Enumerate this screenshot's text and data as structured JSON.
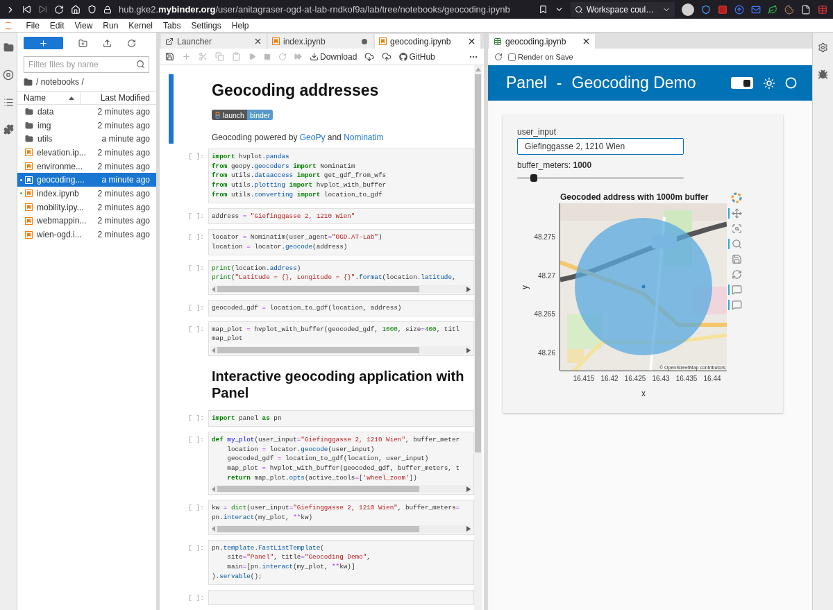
{
  "browser": {
    "url": "hub.gke2.**mybinder.org**/user/anitagraser-ogd-at-lab-rndkof9a/lab/tree/notebooks/geocoding.ipynb",
    "search": "Workspace coul…"
  },
  "menu": [
    "File",
    "Edit",
    "View",
    "Run",
    "Kernel",
    "Tabs",
    "Settings",
    "Help"
  ],
  "file_browser": {
    "filter_placeholder": "Filter files by name",
    "path": "/ notebooks /",
    "columns": [
      "Name",
      "Last Modified"
    ],
    "items": [
      {
        "kind": "folder",
        "name": "data",
        "modified": "2 minutes ago",
        "selected": false,
        "running": false
      },
      {
        "kind": "folder",
        "name": "img",
        "modified": "2 minutes ago",
        "selected": false,
        "running": false
      },
      {
        "kind": "folder",
        "name": "utils",
        "modified": "a minute ago",
        "selected": false,
        "running": false
      },
      {
        "kind": "notebook",
        "name": "elevation.ip...",
        "modified": "2 minutes ago",
        "selected": false,
        "running": false
      },
      {
        "kind": "notebook",
        "name": "environme...",
        "modified": "2 minutes ago",
        "selected": false,
        "running": false
      },
      {
        "kind": "notebook",
        "name": "geocoding....",
        "modified": "a minute ago",
        "selected": true,
        "running": true
      },
      {
        "kind": "notebook",
        "name": "index.ipynb",
        "modified": "2 minutes ago",
        "selected": false,
        "running": true
      },
      {
        "kind": "notebook",
        "name": "mobility.ipy...",
        "modified": "2 minutes ago",
        "selected": false,
        "running": false
      },
      {
        "kind": "notebook",
        "name": "webmappin...",
        "modified": "2 minutes ago",
        "selected": false,
        "running": false
      },
      {
        "kind": "notebook",
        "name": "wien-ogd.i...",
        "modified": "2 minutes ago",
        "selected": false,
        "running": false
      }
    ]
  },
  "notebook": {
    "tabs": [
      {
        "kind": "launcher",
        "label": "Launcher",
        "selected": false,
        "modified": false
      },
      {
        "kind": "notebook",
        "label": "index.ipynb",
        "selected": false,
        "modified": true
      },
      {
        "kind": "notebook",
        "label": "geocoding.ipynb",
        "selected": true,
        "modified": false
      }
    ],
    "toolbar": {
      "download": "Download",
      "github": "GitHub"
    },
    "cells": [
      {
        "kind": "markdown",
        "active": true,
        "heading": "Geocoding addresses",
        "badge": [
          "launch",
          "binder"
        ],
        "paragraph": [
          {
            "text": "Geocoding powered by ",
            "link": false
          },
          {
            "text": "GeoPy",
            "link": true
          },
          {
            "text": " and ",
            "link": false
          },
          {
            "text": "Nominatim",
            "link": true
          }
        ]
      },
      {
        "kind": "code",
        "active": false,
        "prompt": "[ ]:",
        "scrollbar": false,
        "lines": [
          [
            {
              "kind": "keyword",
              "text": "import"
            },
            {
              "kind": "plain",
              "text": " hvplot."
            },
            {
              "kind": "attribute",
              "text": "pandas"
            }
          ],
          [
            {
              "kind": "keyword",
              "text": "from"
            },
            {
              "kind": "plain",
              "text": " geopy."
            },
            {
              "kind": "attribute",
              "text": "geocoders"
            },
            {
              "kind": "keyword",
              "text": " import"
            },
            {
              "kind": "plain",
              "text": " Nominatim"
            }
          ],
          [
            {
              "kind": "keyword",
              "text": "from"
            },
            {
              "kind": "plain",
              "text": " utils."
            },
            {
              "kind": "attribute",
              "text": "dataaccess"
            },
            {
              "kind": "keyword",
              "text": " import"
            },
            {
              "kind": "plain",
              "text": " get_gdf_from_wfs"
            }
          ],
          [
            {
              "kind": "keyword",
              "text": "from"
            },
            {
              "kind": "plain",
              "text": " utils."
            },
            {
              "kind": "attribute",
              "text": "plotting"
            },
            {
              "kind": "keyword",
              "text": " import"
            },
            {
              "kind": "plain",
              "text": " hvplot_with_buffer"
            }
          ],
          [
            {
              "kind": "keyword",
              "text": "from"
            },
            {
              "kind": "plain",
              "text": " utils."
            },
            {
              "kind": "attribute",
              "text": "converting"
            },
            {
              "kind": "keyword",
              "text": " import"
            },
            {
              "kind": "plain",
              "text": " location_to_gdf"
            }
          ]
        ]
      },
      {
        "kind": "code",
        "active": false,
        "prompt": "[ ]:",
        "scrollbar": false,
        "lines": [
          [
            {
              "kind": "plain",
              "text": "address "
            },
            {
              "kind": "operator",
              "text": "="
            },
            {
              "kind": "string",
              "text": " \"Giefinggasse 2, 1210 Wien\""
            }
          ]
        ]
      },
      {
        "kind": "code",
        "active": false,
        "prompt": "[ ]:",
        "scrollbar": false,
        "lines": [
          [
            {
              "kind": "plain",
              "text": "locator "
            },
            {
              "kind": "operator",
              "text": "="
            },
            {
              "kind": "plain",
              "text": " Nominatim(user_agent"
            },
            {
              "kind": "operator",
              "text": "="
            },
            {
              "kind": "string",
              "text": "\"OGD.AT-Lab\""
            },
            {
              "kind": "plain",
              "text": ")"
            }
          ],
          [
            {
              "kind": "plain",
              "text": "location "
            },
            {
              "kind": "operator",
              "text": "="
            },
            {
              "kind": "plain",
              "text": " locator."
            },
            {
              "kind": "attribute",
              "text": "geocode"
            },
            {
              "kind": "plain",
              "text": "(address)"
            }
          ]
        ]
      },
      {
        "kind": "code",
        "active": false,
        "prompt": "[ ]:",
        "scrollbar": true,
        "lines": [
          [
            {
              "kind": "builtin",
              "text": "print"
            },
            {
              "kind": "plain",
              "text": "(location."
            },
            {
              "kind": "attribute",
              "text": "address"
            },
            {
              "kind": "plain",
              "text": ")"
            }
          ],
          [
            {
              "kind": "builtin",
              "text": "print"
            },
            {
              "kind": "plain",
              "text": "("
            },
            {
              "kind": "string",
              "text": "\"Latitude = {}, Longitude = {}\""
            },
            {
              "kind": "plain",
              "text": "."
            },
            {
              "kind": "attribute",
              "text": "format"
            },
            {
              "kind": "plain",
              "text": "(location."
            },
            {
              "kind": "attribute",
              "text": "latitude"
            },
            {
              "kind": "plain",
              "text": ","
            }
          ]
        ]
      },
      {
        "kind": "code",
        "active": false,
        "prompt": "[ ]:",
        "scrollbar": false,
        "lines": [
          [
            {
              "kind": "plain",
              "text": "geocoded_gdf "
            },
            {
              "kind": "operator",
              "text": "="
            },
            {
              "kind": "plain",
              "text": " location_to_gdf(location, address)"
            }
          ]
        ]
      },
      {
        "kind": "code",
        "active": false,
        "prompt": "[ ]:",
        "scrollbar": true,
        "lines": [
          [
            {
              "kind": "plain",
              "text": "map_plot "
            },
            {
              "kind": "operator",
              "text": "="
            },
            {
              "kind": "plain",
              "text": " hvplot_with_buffer(geocoded_gdf, "
            },
            {
              "kind": "number",
              "text": "1000"
            },
            {
              "kind": "plain",
              "text": ", size"
            },
            {
              "kind": "operator",
              "text": "="
            },
            {
              "kind": "number",
              "text": "400"
            },
            {
              "kind": "plain",
              "text": ", titl"
            }
          ],
          [
            {
              "kind": "plain",
              "text": "map_plot"
            }
          ]
        ]
      },
      {
        "kind": "heading",
        "active": false,
        "heading": "Interactive geocoding application with Panel"
      },
      {
        "kind": "code",
        "active": false,
        "prompt": "[ ]:",
        "scrollbar": false,
        "lines": [
          [
            {
              "kind": "keyword",
              "text": "import"
            },
            {
              "kind": "plain",
              "text": " panel "
            },
            {
              "kind": "keyword",
              "text": "as"
            },
            {
              "kind": "plain",
              "text": " pn"
            }
          ]
        ]
      },
      {
        "kind": "code",
        "active": false,
        "prompt": "[ ]:",
        "scrollbar": true,
        "lines": [
          [
            {
              "kind": "keyword",
              "text": "def"
            },
            {
              "kind": "function",
              "text": " my_plot"
            },
            {
              "kind": "plain",
              "text": "(user_input"
            },
            {
              "kind": "operator",
              "text": "="
            },
            {
              "kind": "string",
              "text": "\"Giefinggasse 2, 1210 Wien\""
            },
            {
              "kind": "plain",
              "text": ", buffer_meter"
            }
          ],
          [
            {
              "kind": "plain",
              "text": "    location "
            },
            {
              "kind": "operator",
              "text": "="
            },
            {
              "kind": "plain",
              "text": " locator."
            },
            {
              "kind": "attribute",
              "text": "geocode"
            },
            {
              "kind": "plain",
              "text": "(user_input)"
            }
          ],
          [
            {
              "kind": "plain",
              "text": "    geocoded_gdf "
            },
            {
              "kind": "operator",
              "text": "="
            },
            {
              "kind": "plain",
              "text": " location_to_gdf(location, user_input)"
            }
          ],
          [
            {
              "kind": "plain",
              "text": "    map_plot "
            },
            {
              "kind": "operator",
              "text": "="
            },
            {
              "kind": "plain",
              "text": " hvplot_with_buffer(geocoded_gdf, buffer_meters, t"
            }
          ],
          [
            {
              "kind": "keyword",
              "text": "    return"
            },
            {
              "kind": "plain",
              "text": " map_plot."
            },
            {
              "kind": "attribute",
              "text": "opts"
            },
            {
              "kind": "plain",
              "text": "(active_tools"
            },
            {
              "kind": "operator",
              "text": "="
            },
            {
              "kind": "plain",
              "text": "["
            },
            {
              "kind": "string",
              "text": "'wheel_zoom'"
            },
            {
              "kind": "plain",
              "text": "])"
            }
          ]
        ]
      },
      {
        "kind": "code",
        "active": false,
        "prompt": "[ ]:",
        "scrollbar": true,
        "lines": [
          [
            {
              "kind": "plain",
              "text": "kw "
            },
            {
              "kind": "operator",
              "text": "="
            },
            {
              "kind": "builtin",
              "text": " dict"
            },
            {
              "kind": "plain",
              "text": "(user_input"
            },
            {
              "kind": "operator",
              "text": "="
            },
            {
              "kind": "string",
              "text": "\"Giefinggasse 2, 1210 Wien\""
            },
            {
              "kind": "plain",
              "text": ", buffer_meters"
            },
            {
              "kind": "operator",
              "text": "="
            }
          ],
          [
            {
              "kind": "plain",
              "text": "pn."
            },
            {
              "kind": "attribute",
              "text": "interact"
            },
            {
              "kind": "plain",
              "text": "(my_plot, "
            },
            {
              "kind": "operator",
              "text": "**"
            },
            {
              "kind": "plain",
              "text": "kw)"
            }
          ]
        ]
      },
      {
        "kind": "code",
        "active": false,
        "prompt": "[ ]:",
        "scrollbar": false,
        "lines": [
          [
            {
              "kind": "plain",
              "text": "pn."
            },
            {
              "kind": "attribute",
              "text": "template"
            },
            {
              "kind": "plain",
              "text": "."
            },
            {
              "kind": "attribute",
              "text": "FastListTemplate"
            },
            {
              "kind": "plain",
              "text": "("
            }
          ],
          [
            {
              "kind": "plain",
              "text": "    site"
            },
            {
              "kind": "operator",
              "text": "="
            },
            {
              "kind": "string",
              "text": "\"Panel\""
            },
            {
              "kind": "plain",
              "text": ", title"
            },
            {
              "kind": "operator",
              "text": "="
            },
            {
              "kind": "string",
              "text": "\"Geocoding Demo\""
            },
            {
              "kind": "plain",
              "text": ","
            }
          ],
          [
            {
              "kind": "plain",
              "text": "    main"
            },
            {
              "kind": "operator",
              "text": "="
            },
            {
              "kind": "plain",
              "text": "[pn."
            },
            {
              "kind": "attribute",
              "text": "interact"
            },
            {
              "kind": "plain",
              "text": "(my_plot, "
            },
            {
              "kind": "operator",
              "text": "**"
            },
            {
              "kind": "plain",
              "text": "kw)]"
            }
          ],
          [
            {
              "kind": "plain",
              "text": ")."
            },
            {
              "kind": "attribute",
              "text": "servable"
            },
            {
              "kind": "plain",
              "text": "();"
            }
          ]
        ]
      },
      {
        "kind": "code",
        "active": false,
        "prompt": "[ ]:",
        "scrollbar": false
      }
    ]
  },
  "preview": {
    "tab": "geocoding.ipynb",
    "render_on_save": {
      "label": "Render on Save",
      "checked": false
    },
    "header": {
      "site": "Panel",
      "separator": "-",
      "title": "Geocoding Demo",
      "theme_toggle_on": true
    },
    "input_label": "user_input",
    "input_value": "Giefinggasse 2, 1210 Wien",
    "slider_label": "buffer_meters: **1000**",
    "level": 0.1,
    "plot": {
      "title": "Geocoded address with 1000m buffer",
      "ylabel": "y",
      "xlabel": "x",
      "yticks": [
        "48.275",
        "48.27",
        "48.265",
        "48.26"
      ],
      "xticks": [
        "16.415",
        "16.42",
        "16.425",
        "16.43",
        "16.435",
        "16.44"
      ],
      "attribution": "© OpenStreetMap contributors",
      "tools": [
        {
          "kind": "pan",
          "active": true
        },
        {
          "kind": "box_zoom",
          "active": false
        },
        {
          "kind": "wheel_zoom",
          "active": true
        },
        {
          "kind": "save",
          "active": false
        },
        {
          "kind": "reset",
          "active": false
        },
        {
          "kind": "hover",
          "active": true
        },
        {
          "kind": "hover",
          "active": true
        }
      ]
    }
  }
}
